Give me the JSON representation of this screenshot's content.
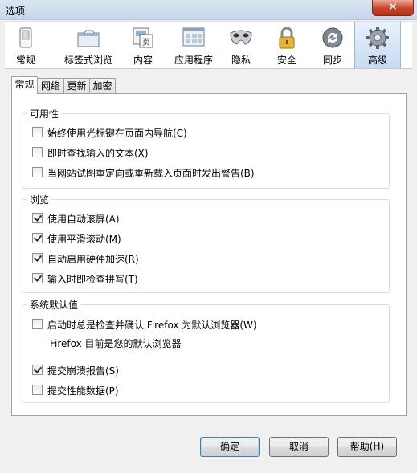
{
  "window": {
    "title": "选项",
    "close_glyph": "✕"
  },
  "toolbar": {
    "panes": [
      {
        "label": "常规",
        "icon": "switch-icon"
      },
      {
        "label": "标签式浏览",
        "icon": "tabs-icon"
      },
      {
        "label": "内容",
        "icon": "content-icon"
      },
      {
        "label": "应用程序",
        "icon": "applications-icon"
      },
      {
        "label": "隐私",
        "icon": "privacy-mask-icon"
      },
      {
        "label": "安全",
        "icon": "padlock-icon"
      },
      {
        "label": "同步",
        "icon": "sync-icon"
      },
      {
        "label": "高级",
        "icon": "gear-icon"
      }
    ],
    "selected": "高级"
  },
  "tabs": [
    "常规",
    "网络",
    "更新",
    "加密"
  ],
  "groups": {
    "accessibility": {
      "title": "可用性",
      "items": [
        {
          "label": "始终使用光标键在页面内导航(C)",
          "checked": false
        },
        {
          "label": "即时查找输入的文本(X)",
          "checked": false
        },
        {
          "label": "当网站试图重定向或重新载入页面时发出警告(B)",
          "checked": false
        }
      ]
    },
    "browsing": {
      "title": "浏览",
      "items": [
        {
          "label": "使用自动滚屏(A)",
          "checked": true
        },
        {
          "label": "使用平滑滚动(M)",
          "checked": true
        },
        {
          "label": "自动启用硬件加速(R)",
          "checked": true
        },
        {
          "label": "输入时即检查拼写(T)",
          "checked": true
        }
      ]
    },
    "system": {
      "title": "系统默认值",
      "default_check": {
        "label": "启动时总是检查并确认 Firefox 为默认浏览器(W)",
        "checked": false
      },
      "note": "Firefox 目前是您的默认浏览器",
      "items": [
        {
          "label": "提交崩溃报告(S)",
          "checked": true
        },
        {
          "label": "提交性能数据(P)",
          "checked": false
        }
      ]
    }
  },
  "buttons": {
    "ok": "确定",
    "cancel": "取消",
    "help": "帮助(H)"
  }
}
